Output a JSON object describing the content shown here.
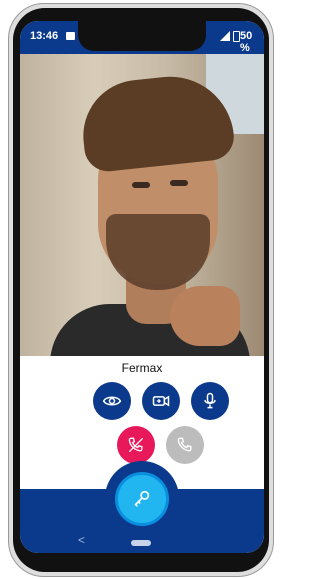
{
  "status_bar": {
    "time": "13:46",
    "battery": "50 %"
  },
  "call": {
    "caller_name": "Fermax"
  },
  "controls": {
    "eye_icon": "eye-icon",
    "switch_camera_icon": "switch-camera-icon",
    "mic_icon": "microphone-icon",
    "end_call_icon": "phone-hangup-icon",
    "accept_icon": "phone-icon",
    "door_icon": "key-icon"
  },
  "nav": {
    "back_glyph": "<"
  },
  "colors": {
    "primary": "#0b3a8c",
    "hangup": "#e8195a",
    "door": "#21b6f0",
    "disabled": "#bcbcbc"
  }
}
